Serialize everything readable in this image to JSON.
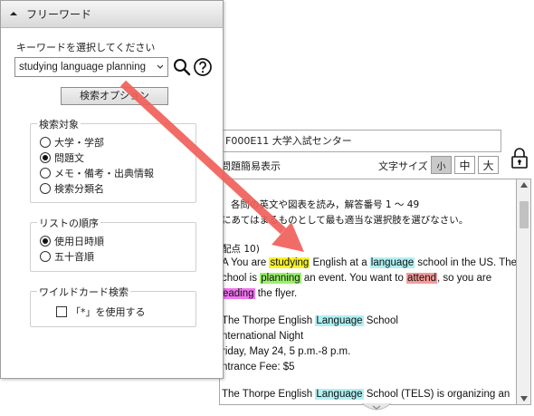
{
  "panel": {
    "title": "フリーワード",
    "keyword_label": "キーワードを選択してください",
    "keyword_value": "studying language planning",
    "options_button": "検索オプション",
    "search_target": {
      "title": "検索対象",
      "options": [
        "大学・学部",
        "問題文",
        "メモ・備考・出典情報",
        "検索分類名"
      ],
      "selected": "問題文"
    },
    "list_order": {
      "title": "リストの順序",
      "options": [
        "使用日時順",
        "五十音順"
      ],
      "selected": "使用日時順"
    },
    "wildcard": {
      "title": "ワイルドカード検索",
      "checkbox_label": "「*」を使用する",
      "checked": false
    }
  },
  "document": {
    "code_title": "F000E11 大学入試センター",
    "mode_label": "問題簡易表示",
    "font_size_label": "文字サイズ",
    "font_sizes": [
      "小",
      "中",
      "大"
    ],
    "selected_font_size": "小",
    "lines": [
      "各問の英文や図表を読み，解答番号  1  ～  49",
      "にあてはまるものとして最も適当な選択肢を選びなさい。",
      "配点  10)",
      "A  You are studying English at a language school in the US. The",
      "chool is planning an event. You want to attend, so you are",
      "eading the flyer.",
      "The Thorpe English Language School",
      "nternational Night",
      "riday, May 24, 5 p.m.-8 p.m.",
      "ntrance Fee: $5",
      "The Thorpe English Language School (TELS) is organizing an"
    ]
  },
  "colors": {
    "highlight_studying": "#f7f227",
    "highlight_language": "#aef0f3",
    "highlight_planning": "#9af06a",
    "highlight_attend": "#f39a9a",
    "highlight_reading": "#ef76ef",
    "arrow": "#f0605a"
  }
}
